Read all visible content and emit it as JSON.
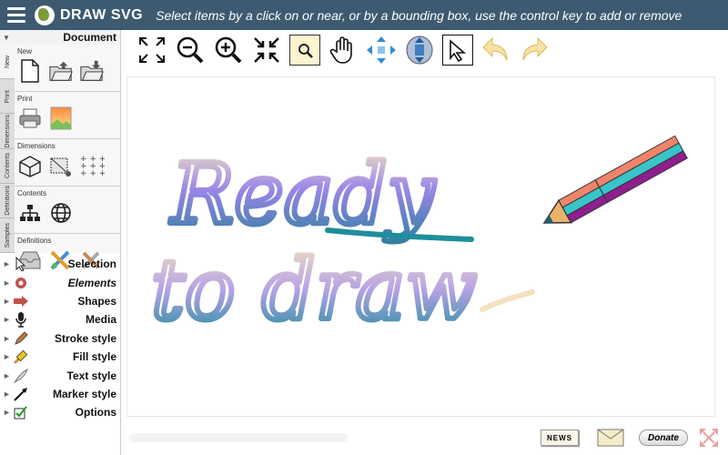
{
  "app": {
    "title": "DRAW SVG",
    "instructions": "Select items by a click on or near, or by a bounding box, use the control key to add or remove"
  },
  "document_panel": {
    "title": "Document",
    "vertical_tabs": [
      "New",
      "Print",
      "Dimensions",
      "Contents",
      "Definitions",
      "Samples"
    ],
    "sections": [
      {
        "label": "New",
        "icons": [
          "new-document-icon",
          "open-folder-icon",
          "save-folder-icon"
        ]
      },
      {
        "label": "Print",
        "icons": [
          "printer-icon",
          "export-image-icon"
        ]
      },
      {
        "label": "Dimensions",
        "icons": [
          "box-dimensions-icon",
          "resize-box-icon",
          "grid-dots-icon"
        ]
      },
      {
        "label": "Contents",
        "icons": [
          "hierarchy-icon",
          "globe-icon"
        ]
      },
      {
        "label": "Definitions",
        "icons": [
          "inbox-icon",
          "tools-icon",
          "wrench-icon"
        ]
      }
    ]
  },
  "menu": [
    {
      "label": "Selection",
      "icon": "cursor-icon",
      "italic": false
    },
    {
      "label": "Elements",
      "icon": "gear-elements-icon",
      "italic": true
    },
    {
      "label": "Shapes",
      "icon": "shapes-arrow-icon",
      "italic": false
    },
    {
      "label": "Media",
      "icon": "microphone-icon",
      "italic": false
    },
    {
      "label": "Stroke style",
      "icon": "pen-icon",
      "italic": false
    },
    {
      "label": "Fill style",
      "icon": "brush-icon",
      "italic": false
    },
    {
      "label": "Text style",
      "icon": "quill-icon",
      "italic": false
    },
    {
      "label": "Marker style",
      "icon": "marker-arrow-icon",
      "italic": false
    },
    {
      "label": "Options",
      "icon": "checkmark-icon",
      "italic": false
    }
  ],
  "toolbar": [
    "fit-view-icon",
    "zoom-out-icon",
    "zoom-in-icon",
    "collapse-icon",
    "zoom-area-icon",
    "pan-hand-icon",
    "move-arrows-icon",
    "scroll-icon",
    "select-pointer-icon",
    "undo-icon",
    "redo-icon"
  ],
  "canvas": {
    "line1": "Ready",
    "line2": "to draw"
  },
  "bottom": {
    "news_label": "NEWS",
    "donate_label": "Donate"
  },
  "colors": {
    "topbar": "#3d5a70",
    "stroke_start": "#f3e1c0",
    "stroke_mid": "#8c78e0",
    "stroke_end": "#1e8e9c"
  }
}
